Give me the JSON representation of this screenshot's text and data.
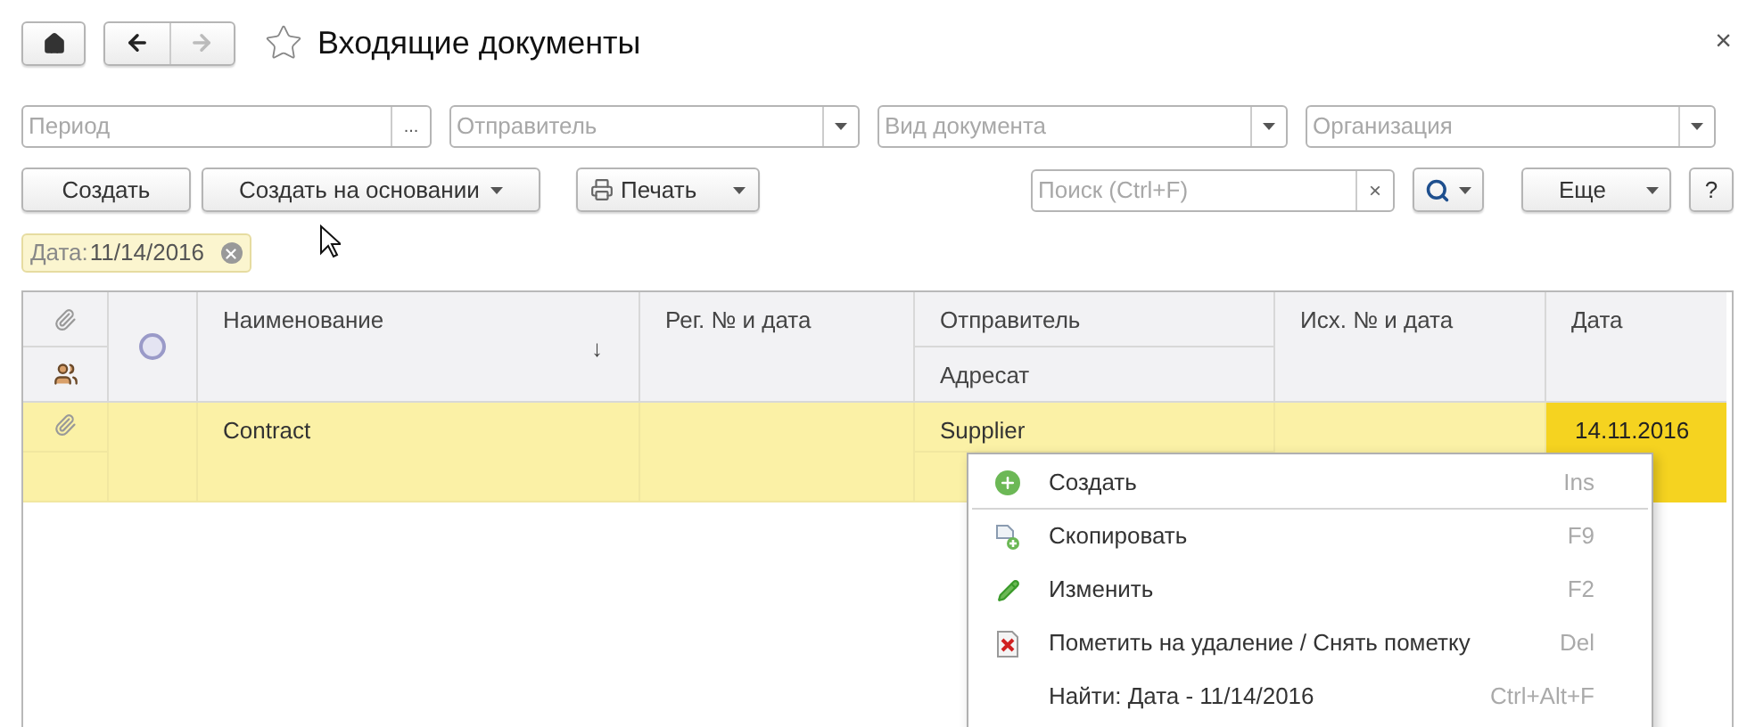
{
  "header": {
    "title": "Входящие документы",
    "favorite": false,
    "back_enabled": true,
    "forward_enabled": false,
    "close": "×"
  },
  "filters": [
    {
      "kind": "period",
      "placeholder": "Период",
      "button": "..."
    },
    {
      "kind": "dropdown",
      "placeholder": "Отправитель"
    },
    {
      "kind": "dropdown",
      "placeholder": "Вид документа"
    },
    {
      "kind": "dropdown",
      "placeholder": "Организация"
    }
  ],
  "actions": [
    {
      "kind": "plain",
      "label": "Создать"
    },
    {
      "kind": "menu",
      "label": "Создать на основании"
    },
    {
      "kind": "print",
      "label": "Печать"
    }
  ],
  "search": {
    "placeholder": "Поиск (Ctrl+F)",
    "clear": "×"
  },
  "more_button": "Еще",
  "help_button": "?",
  "filter_tag": {
    "label": "Дата:",
    "value": "11/14/2016"
  },
  "table": {
    "columns": {
      "name": "Наименование",
      "name_sort": "↓",
      "reg": "Рег. № и дата",
      "sender": "Отправитель",
      "addressee": "Адресат",
      "outgoing": "Исх. № и дата",
      "date": "Дата"
    },
    "rows": [
      {
        "selected": true,
        "has_attachment": true,
        "name": "Contract",
        "sender": "Supplier",
        "date": "14.11.2016"
      }
    ]
  },
  "context_menu": [
    {
      "kind": "add",
      "label": "Создать",
      "shortcut": "Ins",
      "separator_after": true
    },
    {
      "kind": "copy",
      "label": "Скопировать",
      "shortcut": "F9",
      "separator_after": false
    },
    {
      "kind": "edit",
      "label": "Изменить",
      "shortcut": "F2",
      "separator_after": false
    },
    {
      "kind": "delete",
      "label": "Пометить на удаление / Снять пометку",
      "shortcut": "Del",
      "separator_after": false
    },
    {
      "kind": "find",
      "label": "Найти: Дата - 11/14/2016",
      "shortcut": "Ctrl+Alt+F",
      "separator_after": false
    }
  ]
}
